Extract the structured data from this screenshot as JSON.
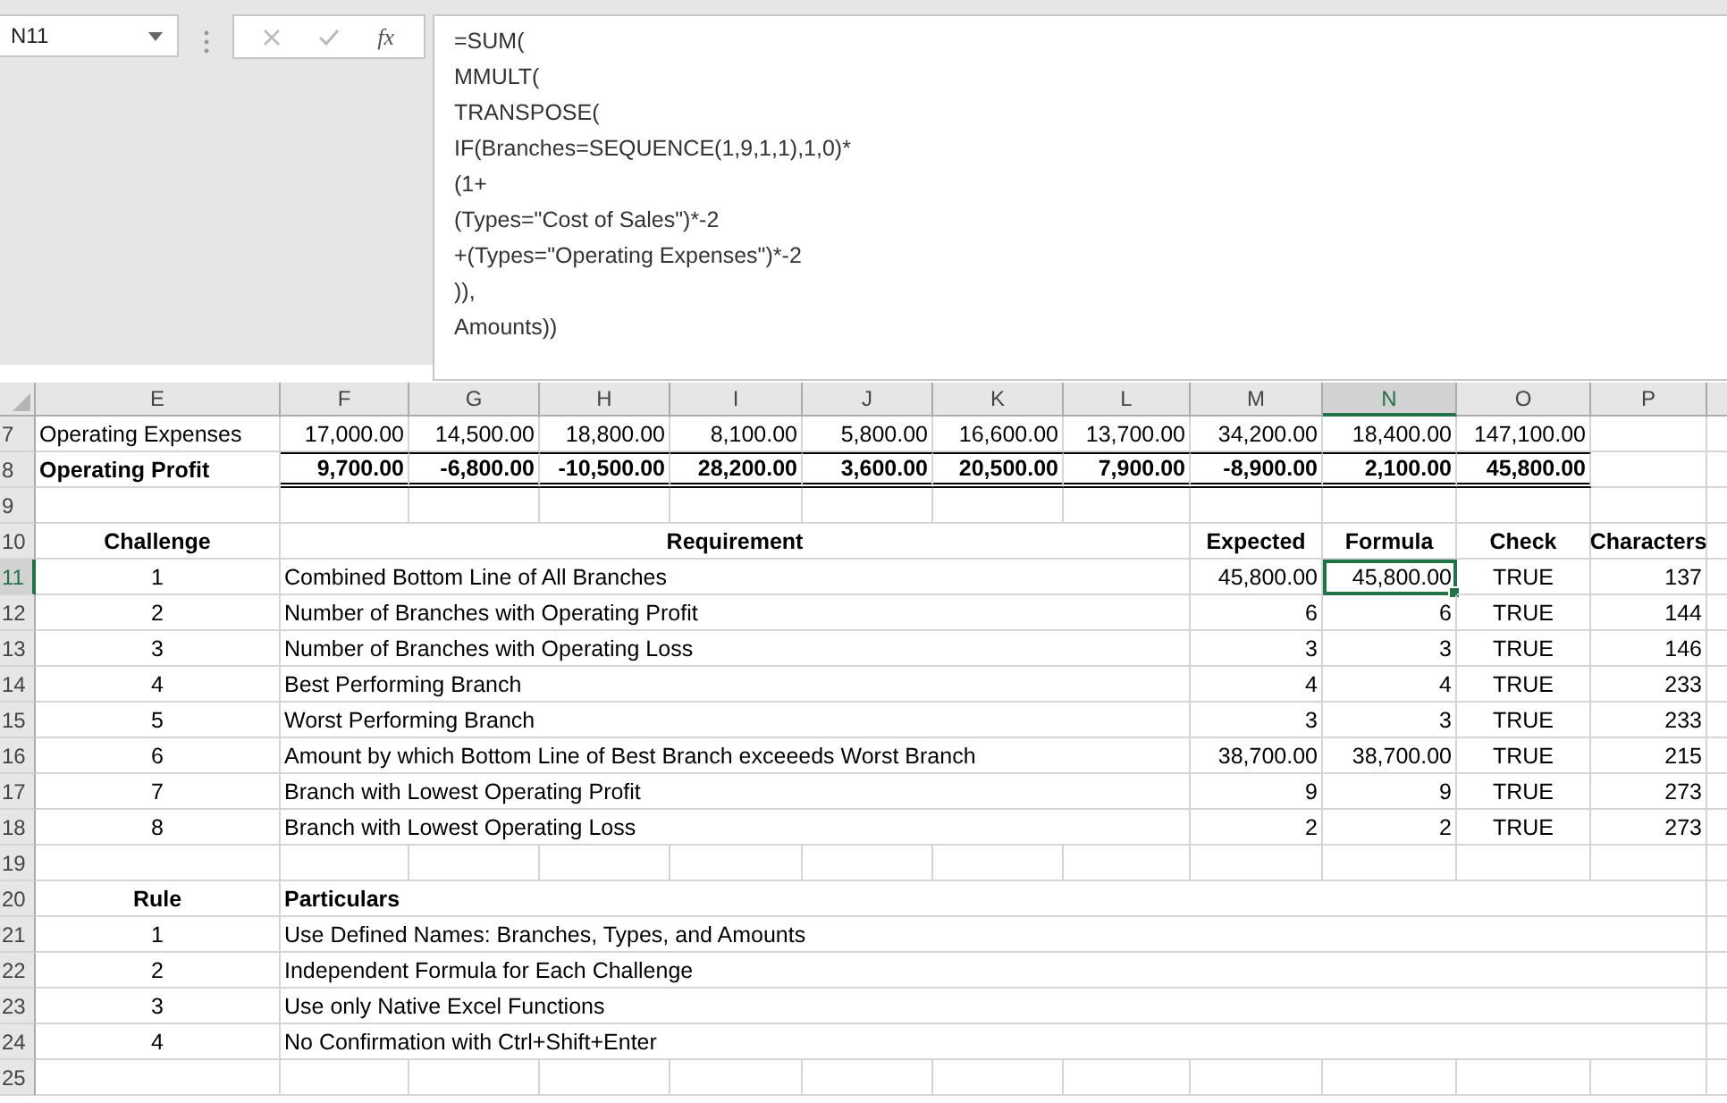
{
  "name_box": "N11",
  "function_label": "fx",
  "formula_lines": [
    "=SUM(",
    "MMULT(",
    "TRANSPOSE(",
    "IF(Branches=SEQUENCE(1,9,1,1),1,0)*",
    "(1+",
    "(Types=\"Cost of Sales\")*-2",
    "+(Types=\"Operating Expenses\")*-2",
    ")),",
    "Amounts))"
  ],
  "column_headers": [
    {
      "label": "E",
      "selected": false
    },
    {
      "label": "F",
      "selected": false
    },
    {
      "label": "G",
      "selected": false
    },
    {
      "label": "H",
      "selected": false
    },
    {
      "label": "I",
      "selected": false
    },
    {
      "label": "J",
      "selected": false
    },
    {
      "label": "K",
      "selected": false
    },
    {
      "label": "L",
      "selected": false
    },
    {
      "label": "M",
      "selected": false
    },
    {
      "label": "N",
      "selected": true
    },
    {
      "label": "O",
      "selected": false
    },
    {
      "label": "P",
      "selected": false
    }
  ],
  "rows": [
    {
      "number": "7",
      "selected": false,
      "kind": "plain",
      "cells": [
        {
          "kind": "label",
          "text": "Operating Expenses"
        },
        {
          "kind": "number",
          "text": "17,000.00"
        },
        {
          "kind": "number",
          "text": "14,500.00"
        },
        {
          "kind": "number",
          "text": "18,800.00"
        },
        {
          "kind": "number",
          "text": "8,100.00"
        },
        {
          "kind": "number",
          "text": "5,800.00"
        },
        {
          "kind": "number",
          "text": "16,600.00"
        },
        {
          "kind": "number",
          "text": "13,700.00"
        },
        {
          "kind": "number",
          "text": "34,200.00"
        },
        {
          "kind": "number",
          "text": "18,400.00"
        },
        {
          "kind": "number",
          "text": "147,100.00"
        }
      ]
    },
    {
      "number": "8",
      "selected": false,
      "kind": "total",
      "cells": [
        {
          "kind": "label",
          "text": "Operating Profit"
        },
        {
          "kind": "number",
          "text": "9,700.00"
        },
        {
          "kind": "number",
          "text": "-6,800.00"
        },
        {
          "kind": "number",
          "text": "-10,500.00"
        },
        {
          "kind": "number",
          "text": "28,200.00"
        },
        {
          "kind": "number",
          "text": "3,600.00"
        },
        {
          "kind": "number",
          "text": "20,500.00"
        },
        {
          "kind": "number",
          "text": "7,900.00"
        },
        {
          "kind": "number",
          "text": "-8,900.00"
        },
        {
          "kind": "number",
          "text": "2,100.00"
        },
        {
          "kind": "number",
          "text": "45,800.00"
        }
      ]
    },
    {
      "number": "9",
      "selected": false,
      "kind": "plain",
      "cells": []
    },
    {
      "number": "10",
      "selected": false,
      "kind": "header",
      "cells": [
        {
          "kind": "heading",
          "text": "Challenge"
        },
        {
          "kind": "heading",
          "text": "Requirement"
        },
        {
          "kind": "empty"
        },
        {
          "kind": "empty"
        },
        {
          "kind": "empty"
        },
        {
          "kind": "empty"
        },
        {
          "kind": "empty"
        },
        {
          "kind": "empty"
        },
        {
          "kind": "heading",
          "text": "Expected"
        },
        {
          "kind": "heading",
          "text": "Formula"
        },
        {
          "kind": "heading",
          "text": "Check"
        },
        {
          "kind": "heading",
          "text": "Characters"
        }
      ]
    },
    {
      "number": "11",
      "selected": true,
      "kind": "plain",
      "cells": [
        {
          "kind": "index",
          "text": "1"
        },
        {
          "kind": "label",
          "text": "Combined Bottom Line of All Branches"
        },
        {
          "kind": "empty"
        },
        {
          "kind": "empty"
        },
        {
          "kind": "empty"
        },
        {
          "kind": "empty"
        },
        {
          "kind": "empty"
        },
        {
          "kind": "empty"
        },
        {
          "kind": "number",
          "text": "45,800.00"
        },
        {
          "kind": "number",
          "text": "45,800.00",
          "selected": true
        },
        {
          "kind": "flag",
          "text": "TRUE"
        },
        {
          "kind": "number",
          "text": "137"
        }
      ]
    },
    {
      "number": "12",
      "selected": false,
      "kind": "plain",
      "cells": [
        {
          "kind": "index",
          "text": "2"
        },
        {
          "kind": "label",
          "text": "Number of Branches with Operating Profit"
        },
        {
          "kind": "empty"
        },
        {
          "kind": "empty"
        },
        {
          "kind": "empty"
        },
        {
          "kind": "empty"
        },
        {
          "kind": "empty"
        },
        {
          "kind": "empty"
        },
        {
          "kind": "number",
          "text": "6"
        },
        {
          "kind": "number",
          "text": "6"
        },
        {
          "kind": "flag",
          "text": "TRUE"
        },
        {
          "kind": "number",
          "text": "144"
        }
      ]
    },
    {
      "number": "13",
      "selected": false,
      "kind": "plain",
      "cells": [
        {
          "kind": "index",
          "text": "3"
        },
        {
          "kind": "label",
          "text": "Number of Branches with Operating Loss"
        },
        {
          "kind": "empty"
        },
        {
          "kind": "empty"
        },
        {
          "kind": "empty"
        },
        {
          "kind": "empty"
        },
        {
          "kind": "empty"
        },
        {
          "kind": "empty"
        },
        {
          "kind": "number",
          "text": "3"
        },
        {
          "kind": "number",
          "text": "3"
        },
        {
          "kind": "flag",
          "text": "TRUE"
        },
        {
          "kind": "number",
          "text": "146"
        }
      ]
    },
    {
      "number": "14",
      "selected": false,
      "kind": "plain",
      "cells": [
        {
          "kind": "index",
          "text": "4"
        },
        {
          "kind": "label",
          "text": "Best Performing Branch"
        },
        {
          "kind": "empty"
        },
        {
          "kind": "empty"
        },
        {
          "kind": "empty"
        },
        {
          "kind": "empty"
        },
        {
          "kind": "empty"
        },
        {
          "kind": "empty"
        },
        {
          "kind": "number",
          "text": "4"
        },
        {
          "kind": "number",
          "text": "4"
        },
        {
          "kind": "flag",
          "text": "TRUE"
        },
        {
          "kind": "number",
          "text": "233"
        }
      ]
    },
    {
      "number": "15",
      "selected": false,
      "kind": "plain",
      "cells": [
        {
          "kind": "index",
          "text": "5"
        },
        {
          "kind": "label",
          "text": "Worst Performing Branch"
        },
        {
          "kind": "empty"
        },
        {
          "kind": "empty"
        },
        {
          "kind": "empty"
        },
        {
          "kind": "empty"
        },
        {
          "kind": "empty"
        },
        {
          "kind": "empty"
        },
        {
          "kind": "number",
          "text": "3"
        },
        {
          "kind": "number",
          "text": "3"
        },
        {
          "kind": "flag",
          "text": "TRUE"
        },
        {
          "kind": "number",
          "text": "233"
        }
      ]
    },
    {
      "number": "16",
      "selected": false,
      "kind": "plain",
      "cells": [
        {
          "kind": "index",
          "text": "6"
        },
        {
          "kind": "label",
          "text": "Amount by which Bottom Line of Best Branch exceeeds Worst Branch"
        },
        {
          "kind": "empty"
        },
        {
          "kind": "empty"
        },
        {
          "kind": "empty"
        },
        {
          "kind": "empty"
        },
        {
          "kind": "empty"
        },
        {
          "kind": "empty"
        },
        {
          "kind": "number",
          "text": "38,700.00"
        },
        {
          "kind": "number",
          "text": "38,700.00"
        },
        {
          "kind": "flag",
          "text": "TRUE"
        },
        {
          "kind": "number",
          "text": "215"
        }
      ]
    },
    {
      "number": "17",
      "selected": false,
      "kind": "plain",
      "cells": [
        {
          "kind": "index",
          "text": "7"
        },
        {
          "kind": "label",
          "text": "Branch with Lowest Operating Profit"
        },
        {
          "kind": "empty"
        },
        {
          "kind": "empty"
        },
        {
          "kind": "empty"
        },
        {
          "kind": "empty"
        },
        {
          "kind": "empty"
        },
        {
          "kind": "empty"
        },
        {
          "kind": "number",
          "text": "9"
        },
        {
          "kind": "number",
          "text": "9"
        },
        {
          "kind": "flag",
          "text": "TRUE"
        },
        {
          "kind": "number",
          "text": "273"
        }
      ]
    },
    {
      "number": "18",
      "selected": false,
      "kind": "plain",
      "cells": [
        {
          "kind": "index",
          "text": "8"
        },
        {
          "kind": "label",
          "text": "Branch with Lowest Operating Loss"
        },
        {
          "kind": "empty"
        },
        {
          "kind": "empty"
        },
        {
          "kind": "empty"
        },
        {
          "kind": "empty"
        },
        {
          "kind": "empty"
        },
        {
          "kind": "empty"
        },
        {
          "kind": "number",
          "text": "2"
        },
        {
          "kind": "number",
          "text": "2"
        },
        {
          "kind": "flag",
          "text": "TRUE"
        },
        {
          "kind": "number",
          "text": "273"
        }
      ]
    },
    {
      "number": "19",
      "selected": false,
      "kind": "plain",
      "cells": []
    },
    {
      "number": "20",
      "selected": false,
      "kind": "header",
      "cells": [
        {
          "kind": "heading",
          "text": "Rule"
        },
        {
          "kind": "label",
          "text": "Particulars"
        }
      ]
    },
    {
      "number": "21",
      "selected": false,
      "kind": "plain",
      "cells": [
        {
          "kind": "index",
          "text": "1"
        },
        {
          "kind": "label",
          "text": "Use Defined Names: Branches, Types, and Amounts"
        }
      ]
    },
    {
      "number": "22",
      "selected": false,
      "kind": "plain",
      "cells": [
        {
          "kind": "index",
          "text": "2"
        },
        {
          "kind": "label",
          "text": "Independent Formula for Each Challenge"
        }
      ]
    },
    {
      "number": "23",
      "selected": false,
      "kind": "plain",
      "cells": [
        {
          "kind": "index",
          "text": "3"
        },
        {
          "kind": "label",
          "text": "Use only Native Excel Functions"
        }
      ]
    },
    {
      "number": "24",
      "selected": false,
      "kind": "plain",
      "cells": [
        {
          "kind": "index",
          "text": "4"
        },
        {
          "kind": "label",
          "text": "No Confirmation with Ctrl+Shift+Enter"
        }
      ]
    },
    {
      "number": "25",
      "selected": false,
      "kind": "plain",
      "cells": []
    }
  ]
}
